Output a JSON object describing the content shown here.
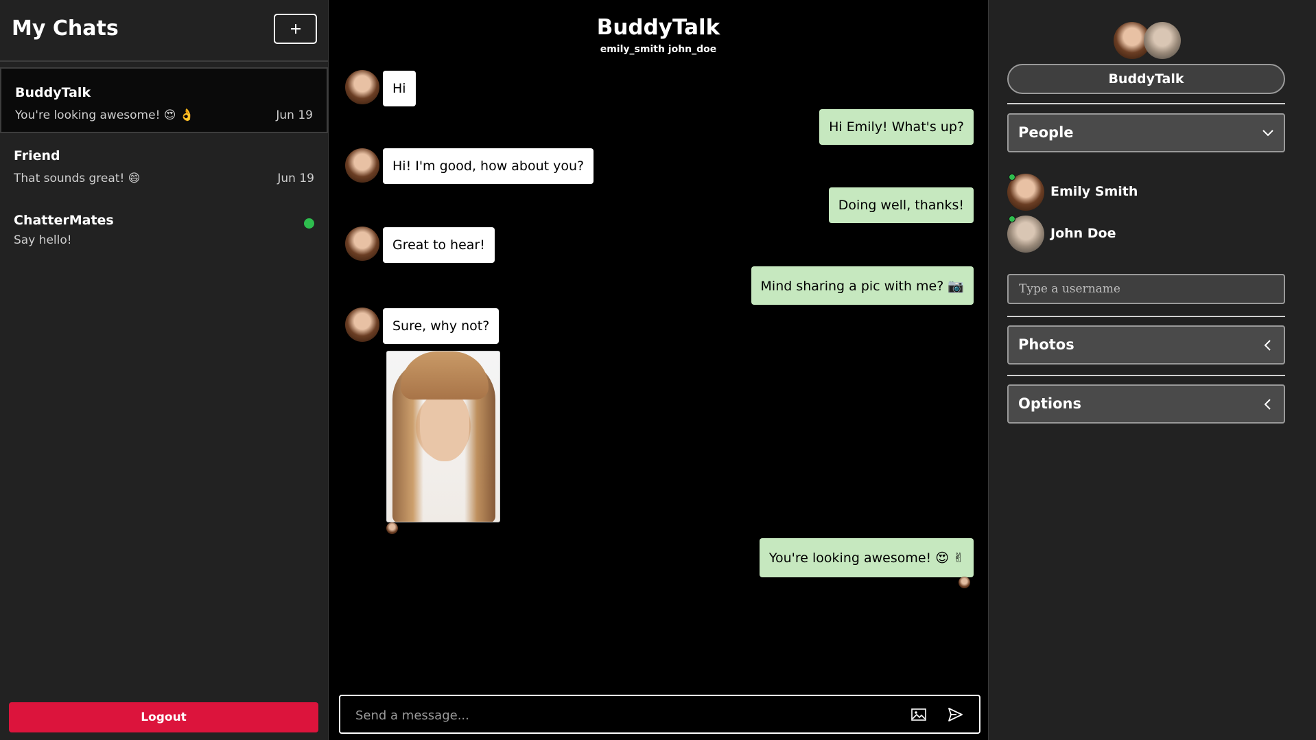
{
  "sidebar": {
    "title": "My Chats",
    "new_chat_icon": "plus-icon",
    "chats": [
      {
        "name": "BuddyTalk",
        "preview": "You're looking awesome! 😍 👌",
        "date": "Jun 19"
      },
      {
        "name": "Friend",
        "preview": "That sounds great! 😄",
        "date": "Jun 19"
      },
      {
        "name": "ChatterMates",
        "preview": "Say hello!",
        "date": ""
      }
    ],
    "logout_label": "Logout"
  },
  "conversation": {
    "title": "BuddyTalk",
    "participants": "emily_smith john_doe",
    "messages": [
      {
        "text": "Hi",
        "direction": "in"
      },
      {
        "text": "Hi Emily! What's up?",
        "direction": "out"
      },
      {
        "text": "Hi! I'm good, how about you?",
        "direction": "in"
      },
      {
        "text": "Doing well, thanks!",
        "direction": "out"
      },
      {
        "text": "Great to hear!",
        "direction": "in"
      },
      {
        "text": "Mind sharing a pic with me? 📷",
        "direction": "out"
      },
      {
        "text": "Sure, why not?",
        "direction": "in"
      },
      {
        "text": "You're looking awesome! 😍 ✌",
        "direction": "out"
      }
    ]
  },
  "composer": {
    "placeholder": "Send a message...",
    "image_icon": "image-icon",
    "send_icon": "send-icon"
  },
  "details": {
    "group_name": "BuddyTalk",
    "people_label": "People",
    "people": [
      {
        "name": "Emily Smith"
      },
      {
        "name": "John Doe"
      }
    ],
    "username_placeholder": "Type a username",
    "photos_label": "Photos",
    "options_label": "Options"
  },
  "colors": {
    "accent_red": "#dc143c",
    "online_green": "#2ebd4e",
    "outgoing_bubble": "#c6e8bf",
    "panel_bg": "#222222"
  }
}
